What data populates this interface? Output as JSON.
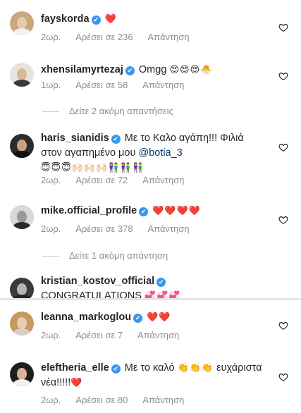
{
  "comments_top": [
    {
      "username": "fayskorda",
      "text": "",
      "emoji": "❤️",
      "time": "2ωρ.",
      "likes": "Αρέσει σε 236",
      "reply": "Απάντηση"
    },
    {
      "username": "xhensilamyrtezaj",
      "text": "Omgg",
      "emoji": "😍😍😍🐣",
      "time": "1ωρ.",
      "likes": "Αρέσει σε 58",
      "reply": "Απάντηση"
    },
    {
      "username": "haris_sianidis",
      "text": "Με το Καλο αγάπη!!! Φιλιά στον αγαπημένο μου",
      "mention": "@botia_3",
      "emoji": "😇😇😇🙌🏻🙌🏻🙌🏻👫👫👫",
      "time": "2ωρ.",
      "likes": "Αρέσει σε 72",
      "reply": "Απάντηση"
    },
    {
      "username": "mike.official_profile",
      "text": "",
      "emoji": "❤️❤️❤️❤️",
      "time": "2ωρ.",
      "likes": "Αρέσει σε 378",
      "reply": "Απάντηση"
    },
    {
      "username": "kristian_kostov_official",
      "text": "CONGRATULATIONS",
      "emoji": "💞💞💞"
    }
  ],
  "view_more": [
    "Δείτε 2 ακόμη απαντήσεις",
    "Δείτε 1 ακόμη απάντηση"
  ],
  "comments_bottom": [
    {
      "username": "leanna_markoglou",
      "text": "",
      "emoji": "❤️❤️",
      "time": "2ωρ.",
      "likes": "Αρέσει σε 7",
      "reply": "Απάντηση"
    },
    {
      "username": "eleftheria_elle",
      "text": "Με το καλό",
      "emoji": "👏👏👏",
      "text2": "ευχάριστα νέα!!!!!",
      "emoji2": "❤️",
      "time": "2ωρ.",
      "likes": "Αρέσει σε 80",
      "reply": "Απάντηση"
    }
  ],
  "icons": {
    "verified": "✔",
    "like": "heart-outline-icon"
  },
  "colors": {
    "verified": "#3897f0",
    "meta": "#8e8e8e",
    "mention": "#00376b"
  }
}
